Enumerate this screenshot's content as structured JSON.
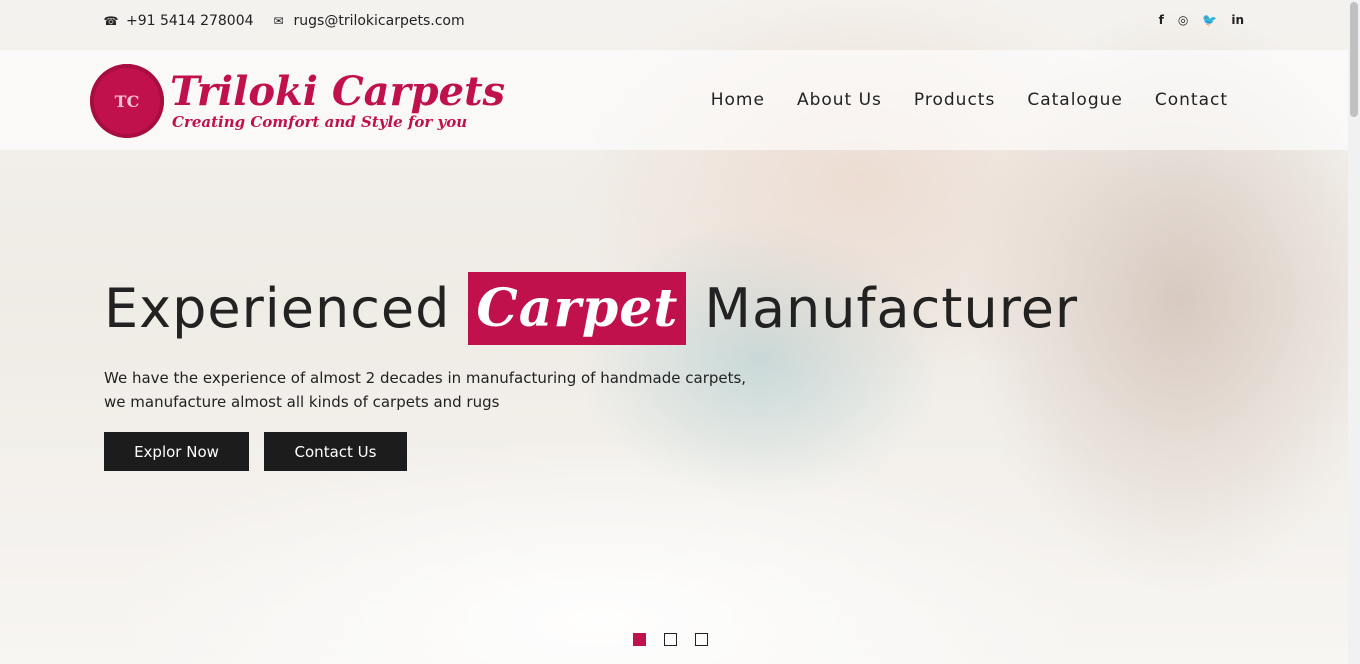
{
  "topbar": {
    "phone": "+91 5414 278004",
    "email": "rugs@trilokicarpets.com",
    "social": [
      {
        "icon": "facebook-icon",
        "glyph": "f"
      },
      {
        "icon": "instagram-icon",
        "glyph": "◎"
      },
      {
        "icon": "twitter-icon",
        "glyph": "🐦"
      },
      {
        "icon": "linkedin-icon",
        "glyph": "in"
      }
    ]
  },
  "logo": {
    "mark": "TC",
    "title": "Triloki Carpets",
    "tagline": "Creating Comfort and Style for you"
  },
  "nav": {
    "items": [
      "Home",
      "About Us",
      "Products",
      "Catalogue",
      "Contact"
    ]
  },
  "hero": {
    "headline_before": "Experienced",
    "headline_accent": "Carpet",
    "headline_after": "Manufacturer",
    "desc_line1": "We have the experience of almost 2 decades in manufacturing of handmade carpets,",
    "desc_line2": "we manufacture almost all kinds of carpets and rugs",
    "btn_explore": "Explor Now",
    "btn_contact": "Contact Us"
  },
  "slider": {
    "count": 3,
    "active": 1
  },
  "colors": {
    "accent": "#c0114d",
    "button": "#1c1c1c"
  }
}
